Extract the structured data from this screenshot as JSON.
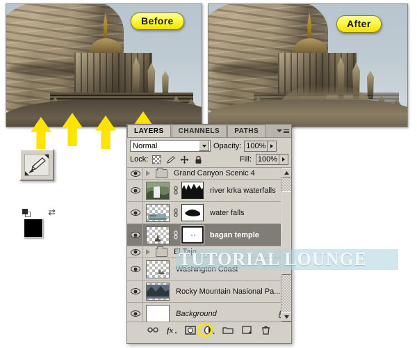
{
  "images": {
    "before": {
      "badge": "Before",
      "alt": "bagan temple composited on rock cliff, hard edge at base"
    },
    "after": {
      "badge": "After",
      "alt": "bagan temple blended into rock cliff with layer mask"
    }
  },
  "annotations": {
    "arrow_count": 4,
    "arrow_color": "#ffe400",
    "arrow_meaning": "points at the hard seam along the temple base"
  },
  "tools": {
    "brush_tool": "brush-tool",
    "foreground_color": "#000000",
    "background_color": "#ffffff",
    "default_colors_label": "default-foreground-background",
    "swap_colors_label": "swap-colors"
  },
  "watermark": {
    "text": "TUTORIAL LOUNGE",
    "band_color": "#add4df"
  },
  "panel": {
    "tabs": [
      {
        "label": "LAYERS",
        "active": true
      },
      {
        "label": "CHANNELS",
        "active": false
      },
      {
        "label": "PATHS",
        "active": false
      }
    ],
    "menu_icon": "panel-menu-icon",
    "blend_mode": "Normal",
    "opacity_label": "Opacity:",
    "opacity_value": "100%",
    "fill_label": "Fill:",
    "fill_value": "100%",
    "lock_label": "Lock:",
    "lock_icons": [
      "lock-transparency-icon",
      "lock-image-icon",
      "lock-position-icon",
      "lock-all-icon"
    ],
    "layers": [
      {
        "name": "Grand Canyon Scenic 4",
        "kind": "group",
        "visible": true,
        "selected": false,
        "expanded": false
      },
      {
        "name": "river krka waterfalls",
        "kind": "layer",
        "visible": true,
        "selected": false,
        "has_mask": true,
        "mask_type": "black-white-curve"
      },
      {
        "name": "water falls",
        "kind": "layer",
        "visible": true,
        "selected": false,
        "has_mask": true,
        "mask_type": "black-blob"
      },
      {
        "name": "bagan temple",
        "kind": "layer",
        "visible": true,
        "selected": true,
        "has_mask": true,
        "mask_type": "white-mask-active"
      },
      {
        "name": "El Tajo",
        "kind": "group",
        "visible": true,
        "selected": false,
        "expanded": false
      },
      {
        "name": "Washington Coast",
        "kind": "layer",
        "visible": true,
        "selected": false,
        "has_mask": false
      },
      {
        "name": "Rocky Mountain Nasional Pa...",
        "kind": "layer",
        "visible": true,
        "selected": false,
        "has_mask": false
      },
      {
        "name": "Background",
        "kind": "background",
        "visible": true,
        "selected": false,
        "locked": true
      }
    ],
    "bottom_buttons": [
      {
        "name": "link-layers-button",
        "icon": "link-icon",
        "highlighted": false
      },
      {
        "name": "layer-style-button",
        "icon": "fx-icon",
        "highlighted": false
      },
      {
        "name": "add-layer-mask-button",
        "icon": "layer-mask-icon",
        "highlighted": true
      },
      {
        "name": "adjustment-layer-button",
        "icon": "half-circle-icon",
        "highlighted": false
      },
      {
        "name": "new-group-button",
        "icon": "folder-icon",
        "highlighted": false
      },
      {
        "name": "new-layer-button",
        "icon": "new-layer-icon",
        "highlighted": false
      },
      {
        "name": "delete-layer-button",
        "icon": "trash-icon",
        "highlighted": false
      }
    ],
    "scrollbar": {
      "up": "scroll-up-arrow",
      "down": "scroll-down-arrow"
    }
  }
}
